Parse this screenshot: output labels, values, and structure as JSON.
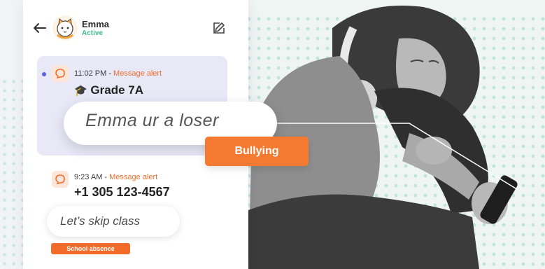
{
  "colors": {
    "accent_orange": "#f26b2a",
    "active_green": "#3dbd8c",
    "unread_blue": "#5b63e0",
    "highlight_card": "#e8e8f7",
    "dots_teal": "#b7e2d6"
  },
  "header": {
    "contact_name": "Emma",
    "contact_status": "Active",
    "back_icon": "arrow-left-icon",
    "edit_icon": "edit-icon",
    "avatar_icon": "cat-avatar-icon"
  },
  "messages": [
    {
      "time": "11:02 PM - ",
      "alert_label": "Message alert",
      "sender_emoji": "🎓",
      "sender": "Grade 7A",
      "text": "Emma ur a loser",
      "tag": "Bullying",
      "unread": true
    },
    {
      "time": "9:23 AM - ",
      "alert_label": "Message alert",
      "sender": "+1 305 123-4567",
      "text": "Let’s skip class",
      "tag": "School absence"
    }
  ]
}
